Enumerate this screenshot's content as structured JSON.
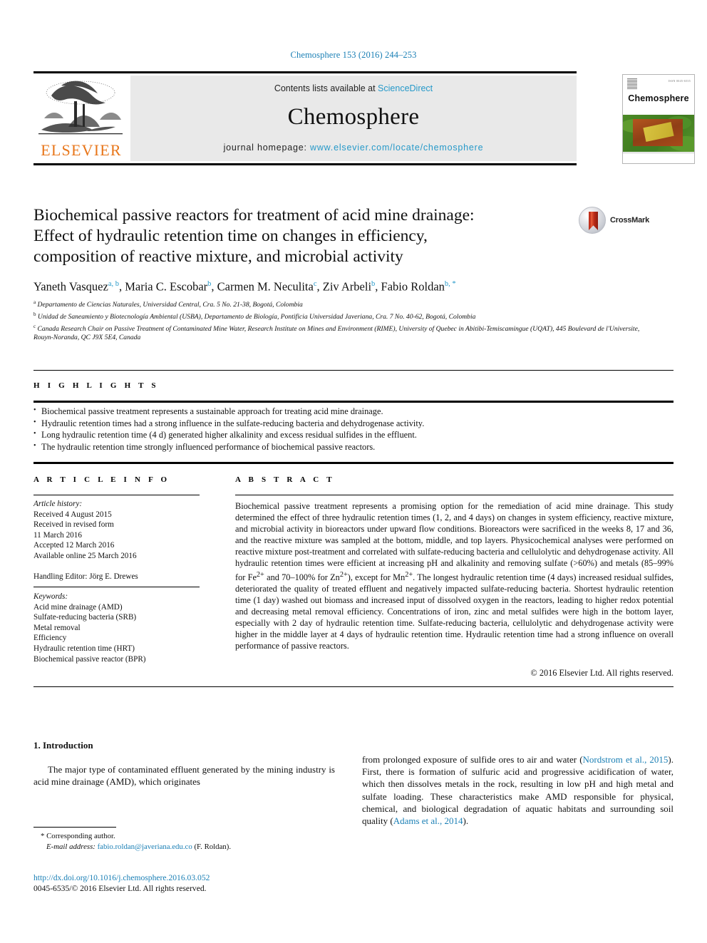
{
  "running_head": "Chemosphere 153 (2016) 244–253",
  "masthead": {
    "contents_prefix": "Contents lists available at ",
    "sciencedirect": "ScienceDirect",
    "journal_title": "Chemosphere",
    "homepage_prefix": "journal homepage: ",
    "homepage_url": "www.elsevier.com/locate/chemosphere",
    "publisher": "ELSEVIER",
    "cover_name": "Chemosphere",
    "cover_issue": "ISSN 0045-6535"
  },
  "article": {
    "title_line1": "Biochemical passive reactors for treatment of acid mine drainage:",
    "title_line2": "Effect of hydraulic retention time on changes in efficiency,",
    "title_line3": "composition of reactive mixture, and microbial activity",
    "crossmark_label": "CrossMark",
    "authors": [
      {
        "name": "Yaneth Vasquez",
        "marks": "a, b",
        "sep": ", "
      },
      {
        "name": "Maria C. Escobar",
        "marks": "b",
        "sep": ", "
      },
      {
        "name": "Carmen M. Neculita",
        "marks": "c",
        "sep": ", "
      },
      {
        "name": "Ziv Arbeli",
        "marks": "b",
        "sep": ", "
      },
      {
        "name": "Fabio Roldan",
        "marks": "b, *",
        "sep": ""
      }
    ],
    "affiliations": [
      {
        "mark": "a",
        "text": "Departamento de Ciencias Naturales, Universidad Central, Cra. 5 No. 21-38, Bogotá, Colombia"
      },
      {
        "mark": "b",
        "text": "Unidad de Saneamiento y Biotecnología Ambiental (USBA), Departamento de Biología, Pontificia Universidad Javeriana, Cra. 7 No. 40-62, Bogotá, Colombia"
      },
      {
        "mark": "c",
        "text": "Canada Research Chair on Passive Treatment of Contaminated Mine Water, Research Institute on Mines and Environment (RIME), University of Quebec in Abitibi-Temiscamingue (UQAT), 445 Boulevard de l'Universite, Rouyn-Noranda, QC J9X 5E4, Canada"
      }
    ]
  },
  "highlights": {
    "label": "H I G H L I G H T S",
    "items": [
      "Biochemical passive treatment represents a sustainable approach for treating acid mine drainage.",
      "Hydraulic retention times had a strong influence in the sulfate-reducing bacteria and dehydrogenase activity.",
      "Long hydraulic retention time (4 d) generated higher alkalinity and excess residual sulfides in the effluent.",
      "The hydraulic retention time strongly influenced performance of biochemical passive reactors."
    ]
  },
  "article_info": {
    "label": "A R T I C L E  I N F O",
    "history_label": "Article history:",
    "history": [
      "Received 4 August 2015",
      "Received in revised form",
      "11 March 2016",
      "Accepted 12 March 2016",
      "Available online 25 March 2016"
    ],
    "handling_editor": "Handling Editor: Jörg E. Drewes",
    "keywords_label": "Keywords:",
    "keywords": [
      "Acid mine drainage (AMD)",
      "Sulfate-reducing bacteria (SRB)",
      "Metal removal",
      "Efficiency",
      "Hydraulic retention time (HRT)",
      "Biochemical passive reactor (BPR)"
    ]
  },
  "abstract": {
    "label": "A B S T R A C T",
    "text_part1": "Biochemical passive treatment represents a promising option for the remediation of acid mine drainage. This study determined the effect of three hydraulic retention times (1, 2, and 4 days) on changes in system efficiency, reactive mixture, and microbial activity in bioreactors under upward flow conditions. Bioreactors were sacrificed in the weeks 8, 17 and 36, and the reactive mixture was sampled at the bottom, middle, and top layers. Physicochemical analyses were performed on reactive mixture post-treatment and correlated with sulfate-reducing bacteria and cellulolytic and dehydrogenase activity. All hydraulic retention times were efficient at increasing pH and alkalinity and removing sulfate (>60%) and metals (85–99% for Fe",
    "sup1": "2+",
    "text_part2": " and 70–100% for Zn",
    "sup2": "2+",
    "text_part3": "), except for Mn",
    "sup3": "2+",
    "text_part4": ". The longest hydraulic retention time (4 days) increased residual sulfides, deteriorated the quality of treated effluent and negatively impacted sulfate-reducing bacteria. Shortest hydraulic retention time (1 day) washed out biomass and increased input of dissolved oxygen in the reactors, leading to higher redox potential and decreasing metal removal efficiency. Concentrations of iron, zinc and metal sulfides were high in the bottom layer, especially with 2 day of hydraulic retention time. Sulfate-reducing bacteria, cellulolytic and dehydrogenase activity were higher in the middle layer at 4 days of hydraulic retention time. Hydraulic retention time had a strong influence on overall performance of passive reactors.",
    "copyright": "© 2016 Elsevier Ltd. All rights reserved."
  },
  "body": {
    "section_number_title": "1. Introduction",
    "left_paragraph": "The major type of contaminated effluent generated by the mining industry is acid mine drainage (AMD), which originates",
    "right_paragraph_a": "from prolonged exposure of sulfide ores to air and water (",
    "right_cite_1": "Nordstrom et al., 2015",
    "right_paragraph_b": "). First, there is formation of sulfuric acid and progressive acidification of water, which then dissolves metals in the rock, resulting in low pH and high metal and sulfate loading. These characteristics make AMD responsible for physical, chemical, and biological degradation of aquatic habitats and surrounding soil quality (",
    "right_cite_2": "Adams et al., 2014",
    "right_paragraph_c": ")."
  },
  "footer": {
    "corresponding_marker": "*",
    "corresponding_label": "Corresponding author.",
    "email_label": "E-mail address:",
    "email": "fabio.roldan@javeriana.edu.co",
    "email_owner": "(F. Roldan).",
    "doi": "http://dx.doi.org/10.1016/j.chemosphere.2016.03.052",
    "issn_line": "0045-6535/© 2016 Elsevier Ltd. All rights reserved."
  },
  "colors": {
    "link_blue": "#1a7fb5",
    "sciencedirect_blue": "#2699c9",
    "elsevier_orange": "#e8761a"
  }
}
